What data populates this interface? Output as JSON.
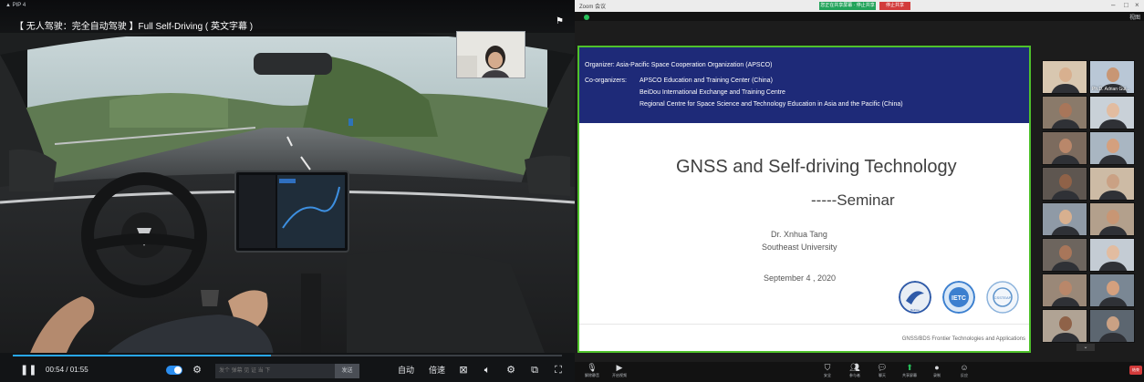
{
  "video": {
    "corner_label": "▲ PIP 4",
    "title": "【 无人驾驶：完全自动驾驶 】Full Self-Driving ( 英文字幕 )",
    "time": "00:54 / 01:55",
    "progress": 0.47,
    "danmaku_placeholder": "发个 弹幕 见 证 当 下",
    "danmaku_send": "发送",
    "controls": [
      "自动",
      "倍速"
    ],
    "accent_color": "#28a7f0"
  },
  "meeting": {
    "app_title": "Zoom 会议",
    "sharing_label": "您正在共享屏幕 · 停止共享",
    "stop_share_label": "停止共享",
    "view_label": "视图",
    "slide": {
      "organizer_line": "Organizer:  Asia-Pacific Space Cooperation Organization (APSCO)",
      "coorganizers_label": "Co-organizers:",
      "coorganizers": [
        "APSCO Education and Training Center (China)",
        "BeiDou International Exchange and Training Centre",
        "Regional Centre for Space Science and Technology Education in Asia and the Pacific (China)"
      ],
      "title": "GNSS and Self-driving Technology",
      "subtitle": "-----Seminar",
      "speaker": "Dr. Xnhua Tang",
      "affiliation": "Southeast University",
      "date": "September 4 , 2020",
      "logos": [
        "BeiDou",
        "IETC",
        "CSSTEAP"
      ],
      "footer": "GNSS/BDS Frontier Technologies and Applications",
      "header_color": "#1e2a78",
      "border_color": "#4fc12b"
    },
    "participants": [
      "",
      "Ph.D. Adrian Gui...",
      "",
      "",
      "",
      "",
      "",
      "",
      "",
      "",
      "",
      "",
      "",
      "",
      "",
      ""
    ],
    "toolbar": [
      "解除静音",
      "开启视频",
      "安全",
      "参与者",
      "聊天",
      "共享屏幕",
      "录制",
      "反应"
    ],
    "end_label": "结束"
  }
}
